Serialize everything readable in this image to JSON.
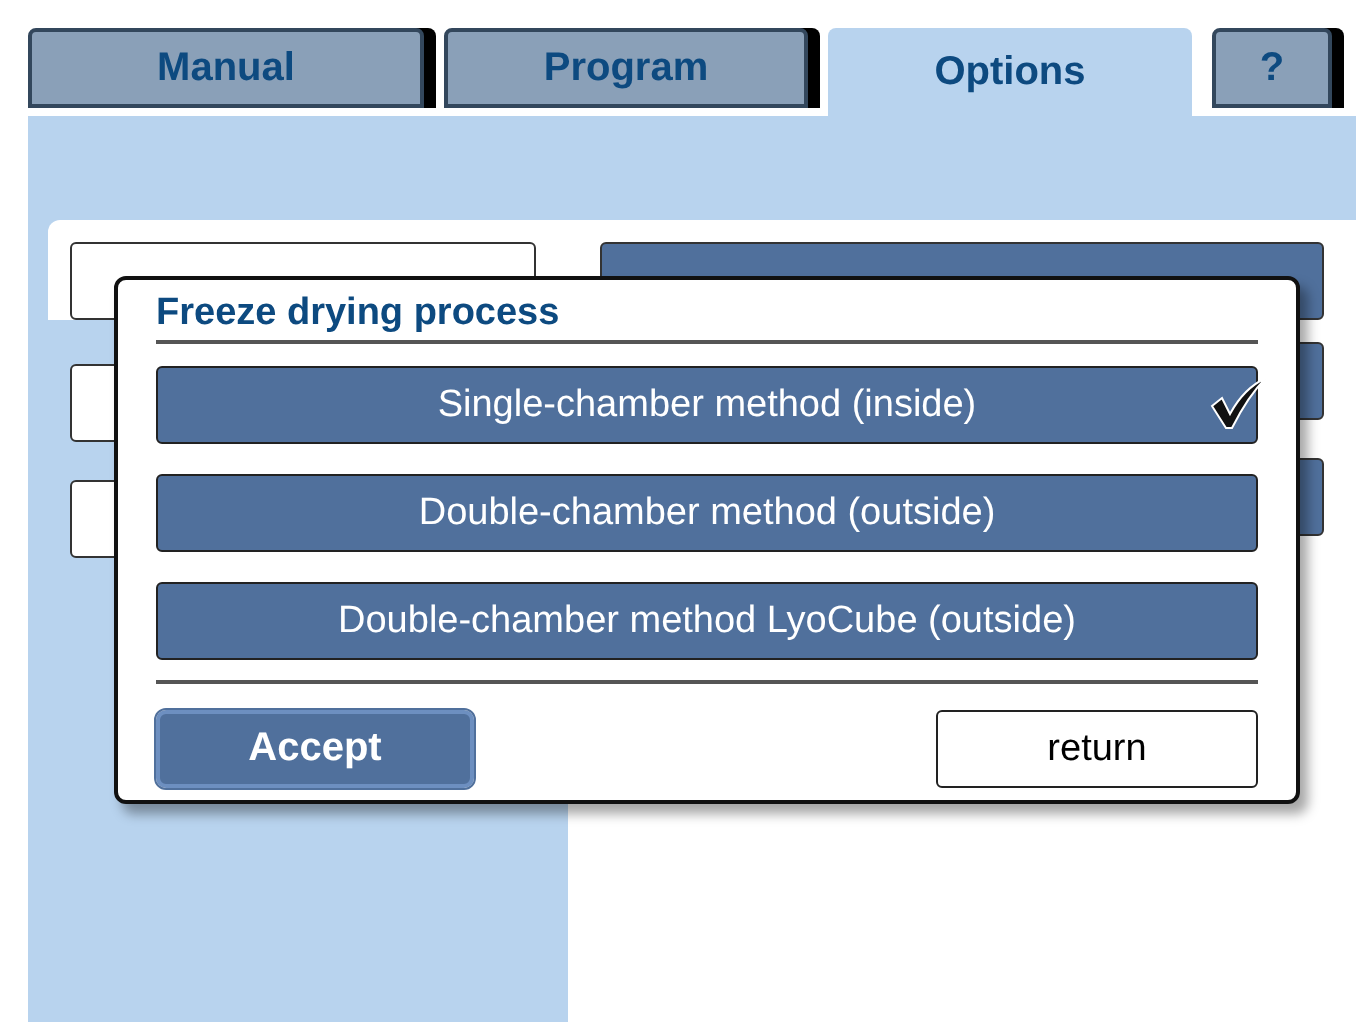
{
  "tabs": [
    {
      "label": "Manual",
      "selected": false
    },
    {
      "label": "Program",
      "selected": false
    },
    {
      "label": "Options",
      "selected": true
    },
    {
      "label": "?",
      "selected": false
    }
  ],
  "dialog": {
    "title": "Freeze drying process",
    "options": [
      {
        "label": "Single-chamber method (inside)",
        "checked": true
      },
      {
        "label": "Double-chamber method (outside)",
        "checked": false
      },
      {
        "label": "Double-chamber method LyoCube (outside)",
        "checked": false
      }
    ],
    "accept": "Accept",
    "return": "return"
  }
}
